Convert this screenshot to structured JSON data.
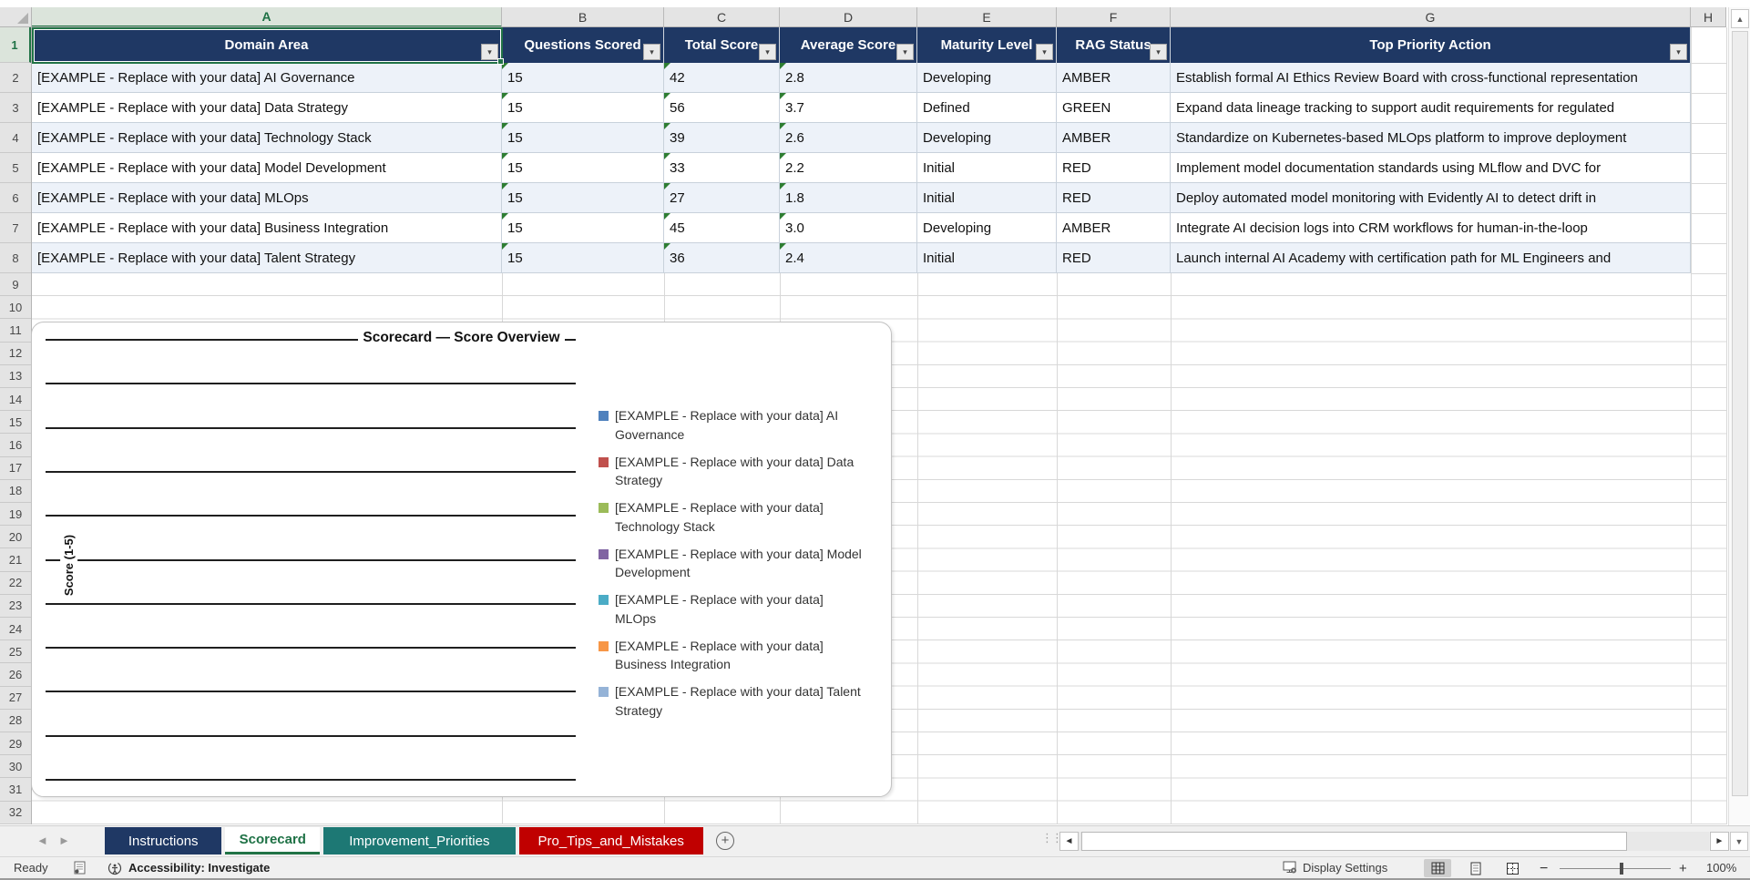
{
  "sheet": {
    "col_letters": [
      "A",
      "B",
      "C",
      "D",
      "E",
      "F",
      "G"
    ],
    "partial_col_letter": "H",
    "active_col": "A",
    "active_row": 1,
    "row_count": 32,
    "headers": [
      "Domain Area",
      "Questions Scored",
      "Total Score",
      "Average Score",
      "Maturity Level",
      "RAG Status",
      "Top Priority Action"
    ],
    "rows": [
      {
        "domain": "[EXAMPLE - Replace with your data] AI Governance",
        "questions": "15",
        "total": "42",
        "avg": "2.8",
        "maturity": "Developing",
        "rag": "AMBER",
        "action": "Establish formal AI Ethics Review Board with cross-functional representation"
      },
      {
        "domain": "[EXAMPLE - Replace with your data] Data Strategy",
        "questions": "15",
        "total": "56",
        "avg": "3.7",
        "maturity": "Defined",
        "rag": "GREEN",
        "action": "Expand data lineage tracking to support audit requirements for regulated"
      },
      {
        "domain": "[EXAMPLE - Replace with your data] Technology Stack",
        "questions": "15",
        "total": "39",
        "avg": "2.6",
        "maturity": "Developing",
        "rag": "AMBER",
        "action": "Standardize on Kubernetes-based MLOps platform to improve deployment"
      },
      {
        "domain": "[EXAMPLE - Replace with your data] Model Development",
        "questions": "15",
        "total": "33",
        "avg": "2.2",
        "maturity": "Initial",
        "rag": "RED",
        "action": "Implement model documentation standards using MLflow and DVC for"
      },
      {
        "domain": "[EXAMPLE - Replace with your data] MLOps",
        "questions": "15",
        "total": "27",
        "avg": "1.8",
        "maturity": "Initial",
        "rag": "RED",
        "action": "Deploy automated model monitoring with Evidently AI to detect drift in"
      },
      {
        "domain": "[EXAMPLE - Replace with your data] Business Integration",
        "questions": "15",
        "total": "45",
        "avg": "3.0",
        "maturity": "Developing",
        "rag": "AMBER",
        "action": "Integrate AI decision logs into CRM workflows for human-in-the-loop"
      },
      {
        "domain": "[EXAMPLE - Replace with your data] Talent Strategy",
        "questions": "15",
        "total": "36",
        "avg": "2.4",
        "maturity": "Initial",
        "rag": "RED",
        "action": "Launch internal AI Academy with certification path for ML Engineers and"
      }
    ],
    "header_bg_color": "#1F3864",
    "band_color": "#EDF2F9",
    "selection_color": "#217346"
  },
  "chart": {
    "title": "Scorecard — Score Overview",
    "ylabel": "Score (1-5)",
    "gridline_count": 11,
    "legend": [
      {
        "line1": "[EXAMPLE - Replace with your data] AI",
        "line2": "Governance",
        "color": "#4F81BD"
      },
      {
        "line1": "[EXAMPLE - Replace with your data] Data",
        "line2": "Strategy",
        "color": "#C0504D"
      },
      {
        "line1": "[EXAMPLE - Replace with your data]",
        "line2": "Technology Stack",
        "color": "#9BBB59"
      },
      {
        "line1": "[EXAMPLE - Replace with your data] Model",
        "line2": "Development",
        "color": "#8064A2"
      },
      {
        "line1": "[EXAMPLE - Replace with your data]",
        "line2": "MLOps",
        "color": "#4BACC6"
      },
      {
        "line1": "[EXAMPLE - Replace with your data]",
        "line2": "Business Integration",
        "color": "#F79646"
      },
      {
        "line1": "[EXAMPLE - Replace with your data] Talent",
        "line2": "Strategy",
        "color": "#95B3D7"
      }
    ]
  },
  "chart_data": {
    "type": "bar",
    "title": "Scorecard — Score Overview",
    "ylabel": "Score (1-5)",
    "series": [
      {
        "name": "[EXAMPLE - Replace with your data] AI Governance",
        "values": []
      },
      {
        "name": "[EXAMPLE - Replace with your data] Data Strategy",
        "values": []
      },
      {
        "name": "[EXAMPLE - Replace with your data] Technology Stack",
        "values": []
      },
      {
        "name": "[EXAMPLE - Replace with your data] Model Development",
        "values": []
      },
      {
        "name": "[EXAMPLE - Replace with your data] MLOps",
        "values": []
      },
      {
        "name": "[EXAMPLE - Replace with your data] Business Integration",
        "values": []
      },
      {
        "name": "[EXAMPLE - Replace with your data] Talent Strategy",
        "values": []
      }
    ],
    "note_plot_area": "empty plot area - gridlines only, no bars rendered",
    "legend_position": "right",
    "grid": true
  },
  "tabs": {
    "items": [
      {
        "label": "Instructions",
        "color": "#1F3864",
        "active": false
      },
      {
        "label": "Scorecard",
        "color": "#FFFFFF",
        "active": true
      },
      {
        "label": "Improvement_Priorities",
        "color": "#1D7874",
        "active": false
      },
      {
        "label": "Pro_Tips_and_Mistakes",
        "color": "#C00000",
        "active": false
      }
    ],
    "new_sheet_label": "+"
  },
  "status_bar": {
    "ready_label": "Ready",
    "accessibility_label": "Accessibility: Investigate",
    "display_settings_label": "Display Settings",
    "zoom_value": "100%",
    "zoom_minus": "−",
    "zoom_plus": "+"
  },
  "icons": {
    "select_all": "select-all-triangle",
    "filter": "filter-dropdown-arrow",
    "scroll_up": "▲",
    "scroll_down": "▼",
    "scroll_left": "◄",
    "scroll_right": "►",
    "tab_nav_left": "◄",
    "tab_nav_right": "►"
  }
}
